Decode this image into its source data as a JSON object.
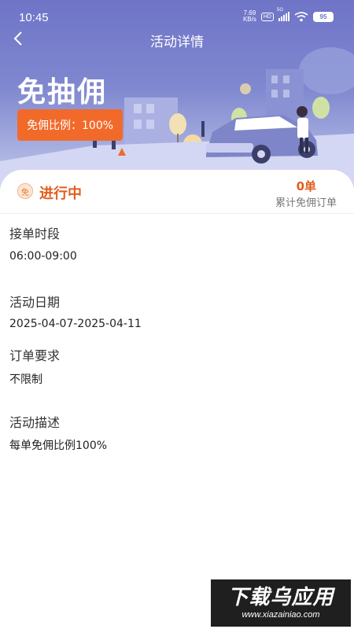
{
  "status_bar": {
    "time": "10:45",
    "net_speed_value": "7.69",
    "net_speed_unit": "KB/s",
    "hd_label": "HD",
    "network_label": "5G",
    "battery": "95"
  },
  "nav": {
    "title": "活动详情"
  },
  "hero": {
    "title": "免抽佣",
    "badge": "免佣比例：100%"
  },
  "status": {
    "icon_text": "免",
    "label": "进行中",
    "count": "0单",
    "count_label": "累计免佣订单"
  },
  "details": [
    {
      "label": "接单时段",
      "value": "06:00-09:00"
    },
    {
      "label": "活动日期",
      "value": "2025-04-07-2025-04-11"
    },
    {
      "label": "订单要求",
      "value": "不限制"
    },
    {
      "label": "活动描述",
      "value": "每单免佣比例100%"
    }
  ],
  "watermark": {
    "title": "下载乌应用",
    "url": "www.xiazainiao.com"
  },
  "colors": {
    "hero_top": "#6f74c7",
    "accent_orange": "#f26a2a",
    "status_orange": "#e35d1e"
  }
}
